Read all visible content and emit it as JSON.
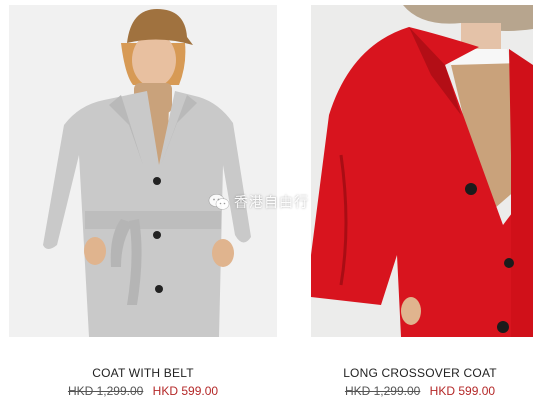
{
  "products": [
    {
      "name": "COAT WITH BELT",
      "original_price": "HKD 1,299.00",
      "sale_price": "HKD 599.00",
      "image": "grey-belted-coat-photo"
    },
    {
      "name": "LONG CROSSOVER COAT",
      "original_price": "HKD 1,299.00",
      "sale_price": "HKD 599.00",
      "image": "red-crossover-coat-photo"
    }
  ],
  "watermark": {
    "text": "香港自由行",
    "icon": "wechat-icon"
  },
  "colors": {
    "sale_price": "#b42828",
    "original_price": "#555555",
    "text": "#222222"
  }
}
